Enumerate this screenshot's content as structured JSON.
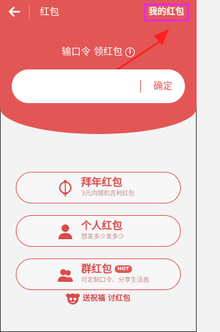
{
  "header": {
    "back_icon": "arrow-left-icon",
    "title": "红包",
    "my_red_packet_label": "我的红包"
  },
  "redeem": {
    "label": "输口令 领红包",
    "info_icon_glyph": "i",
    "input_value": "",
    "confirm_label": "确定"
  },
  "cards": [
    {
      "title": "拜年红包",
      "subtitle": "3元内随机吉利红包",
      "icon": "lantern-icon"
    },
    {
      "title": "个人红包",
      "subtitle": "想发多少发多少",
      "icon": "person-icon"
    },
    {
      "title": "群红包",
      "badge": "HOT",
      "subtitle": "可定制口令、分享生活画",
      "icon": "group-icon"
    }
  ],
  "footer": {
    "text": "送祝福 讨红包",
    "icon": "mascot-icon"
  },
  "colors": {
    "accent": "#e35656",
    "highlight_border": "#e22ce6"
  }
}
